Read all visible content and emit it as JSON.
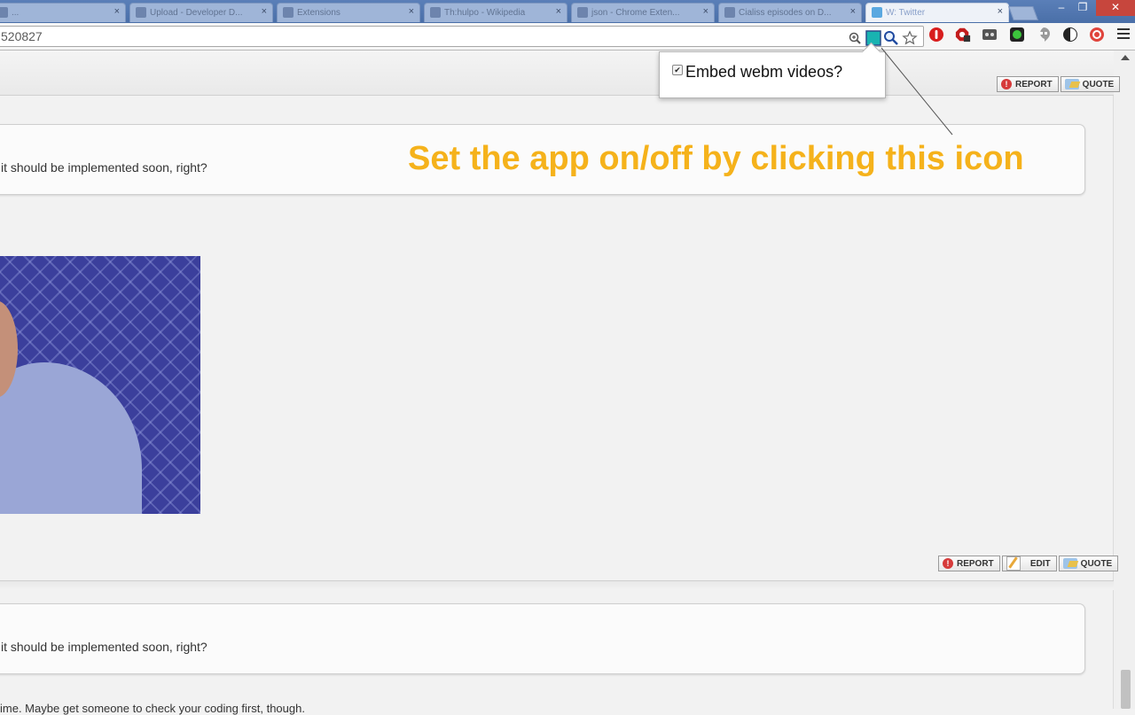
{
  "browser": {
    "tabs": [
      {
        "title": "...",
        "active": false
      },
      {
        "title": "Upload - Developer D...",
        "active": false
      },
      {
        "title": "Extensions",
        "active": false
      },
      {
        "title": "Th:hulpo - Wikipedia",
        "active": false
      },
      {
        "title": "json - Chrome Exten...",
        "active": false
      },
      {
        "title": "Cialiss episodes on D...",
        "active": false
      },
      {
        "title": "W: Twitter",
        "active": true
      }
    ],
    "tab_close_glyph": "×",
    "window_controls": {
      "minimize": "‒",
      "restore": "❐",
      "close": "✕"
    },
    "url_text": "520827",
    "toolbar_icons": [
      "zoom-icon",
      "webm-extension-icon",
      "search-extension-icon",
      "bookmark-star-icon",
      "opera-red-icon",
      "adblock-icon",
      "ghostery-icon",
      "green-square-icon",
      "hangouts-icon",
      "half-moon-icon",
      "pocket-icon",
      "chrome-menu-icon"
    ]
  },
  "popup": {
    "checkbox_checked": true,
    "check_glyph": "✔",
    "label": "Embed webm videos?"
  },
  "annotation": {
    "text": "Set the app on/off by clicking this icon",
    "color": "#f5b21b"
  },
  "posts": {
    "top_buttons": {
      "report": "REPORT",
      "quote": "QUOTE"
    },
    "first_bubble_text": "it should be implemented soon, right?",
    "middle_buttons": {
      "report": "REPORT",
      "edit": "EDIT",
      "quote": "QUOTE"
    },
    "second_bubble_text": "it should be implemented soon, right?",
    "bottom_text": "ime. Maybe get someone to check your coding first, though."
  }
}
